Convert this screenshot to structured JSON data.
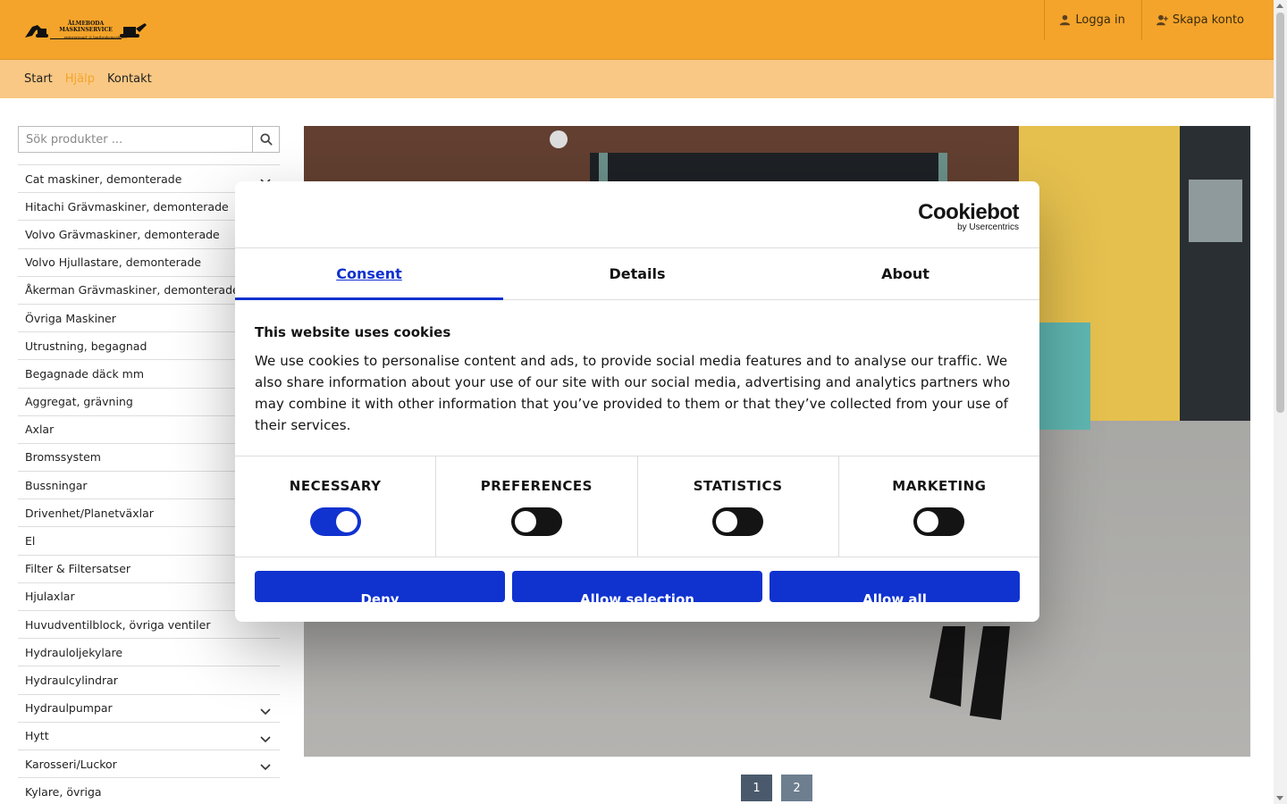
{
  "header": {
    "logo_name": "ÄLMEBODA MASKINSERVICE",
    "logo_tagline": "entreprenad- & lantbruksmaskiner",
    "login_label": "Logga in",
    "register_label": "Skapa konto",
    "brand_color": "#f4a42a"
  },
  "nav": {
    "items": [
      {
        "label": "Start"
      },
      {
        "label": "Hjälp"
      },
      {
        "label": "Kontakt"
      }
    ],
    "active": "Hjälp"
  },
  "sidebar": {
    "search_placeholder": "Sök produkter ...",
    "categories": [
      {
        "label": "Cat maskiner, demonterade",
        "expandable": true
      },
      {
        "label": "Hitachi Grävmaskiner, demonterade",
        "expandable": false
      },
      {
        "label": "Volvo Grävmaskiner, demonterade",
        "expandable": false
      },
      {
        "label": "Volvo Hjullastare, demonterade",
        "expandable": false
      },
      {
        "label": "Åkerman Grävmaskiner, demonterade",
        "expandable": false
      },
      {
        "label": "Övriga Maskiner",
        "expandable": false
      },
      {
        "label": "Utrustning, begagnad",
        "expandable": false
      },
      {
        "label": "Begagnade däck mm",
        "expandable": false
      },
      {
        "label": "Aggregat, grävning",
        "expandable": false
      },
      {
        "label": "Axlar",
        "expandable": false
      },
      {
        "label": "Bromssystem",
        "expandable": false
      },
      {
        "label": "Bussningar",
        "expandable": false
      },
      {
        "label": "Drivenhet/Planetväxlar",
        "expandable": false
      },
      {
        "label": "El",
        "expandable": false
      },
      {
        "label": "Filter & Filtersatser",
        "expandable": false
      },
      {
        "label": "Hjulaxlar",
        "expandable": false
      },
      {
        "label": "Huvudventilblock, övriga ventiler",
        "expandable": false
      },
      {
        "label": "Hydrauloljekylare",
        "expandable": false
      },
      {
        "label": "Hydraulcylindrar",
        "expandable": false
      },
      {
        "label": "Hydraulpumpar",
        "expandable": true
      },
      {
        "label": "Hytt",
        "expandable": true
      },
      {
        "label": "Karosseri/Luckor",
        "expandable": true
      },
      {
        "label": "Kylare, övriga",
        "expandable": false
      }
    ]
  },
  "pagination": {
    "pages": [
      "1",
      "2"
    ],
    "current": "1"
  },
  "cookie_dialog": {
    "brand": "Cookiebot",
    "brand_sub": "by Usercentrics",
    "tabs": [
      {
        "label": "Consent",
        "active": true
      },
      {
        "label": "Details",
        "active": false
      },
      {
        "label": "About",
        "active": false
      }
    ],
    "title": "This website uses cookies",
    "text": "We use cookies to personalise content and ads, to provide social media features and to analyse our traffic. We also share information about your use of our site with our social media, advertising and analytics partners who may combine it with other information that you’ve provided to them or that they’ve collected from your use of their services.",
    "categories": [
      {
        "label": "NECESSARY",
        "on": true
      },
      {
        "label": "PREFERENCES",
        "on": false
      },
      {
        "label": "STATISTICS",
        "on": false
      },
      {
        "label": "MARKETING",
        "on": false
      }
    ],
    "buttons": {
      "deny": "Deny",
      "allow_selection": "Allow selection",
      "allow_all": "Allow all"
    },
    "accent_color": "#1032cf"
  }
}
